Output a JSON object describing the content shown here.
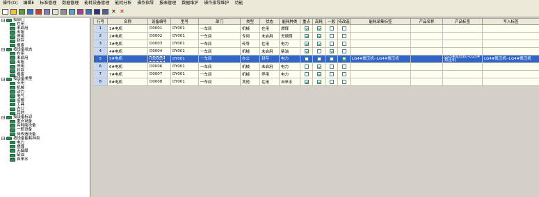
{
  "menu": [
    "操作(O)",
    "编辑E",
    "标准管理",
    "数据管理",
    "能耗设备管理",
    "能耗分析",
    "操作指导",
    "报表管理",
    "数据维护",
    "操作指导维护",
    "功能"
  ],
  "toolbar": {
    "icons": [
      "new-icon",
      "open-icon",
      "save-folder-icon",
      "import-icon",
      "export-icon",
      "grid-icon",
      "report-icon",
      "print-icon",
      "preview-icon",
      "chart-icon",
      "table-icon",
      "disk-icon",
      "save-as-icon",
      "close-x-icon",
      "delete-x-icon"
    ]
  },
  "tree": [
    {
      "level": 0,
      "label": "按部门",
      "expanded": true
    },
    {
      "level": 1,
      "label": "在用"
    },
    {
      "level": 1,
      "label": "未启用"
    },
    {
      "level": 1,
      "label": "出租"
    },
    {
      "level": 1,
      "label": "停用"
    },
    {
      "level": 1,
      "label": "封存"
    },
    {
      "level": 1,
      "label": "报废"
    },
    {
      "level": 0,
      "label": "按设备状态",
      "expanded": true
    },
    {
      "level": 1,
      "label": "在用"
    },
    {
      "level": 1,
      "label": "未启用"
    },
    {
      "level": 1,
      "label": "出租"
    },
    {
      "level": 1,
      "label": "停用"
    },
    {
      "level": 1,
      "label": "封存"
    },
    {
      "level": 1,
      "label": "报废"
    },
    {
      "level": 0,
      "label": "按设备类型",
      "expanded": true
    },
    {
      "level": 1,
      "label": "专用"
    },
    {
      "level": 1,
      "label": "机械"
    },
    {
      "level": 1,
      "label": "动力"
    },
    {
      "level": 1,
      "label": "电气"
    },
    {
      "level": 1,
      "label": "运输"
    },
    {
      "level": 1,
      "label": "工具"
    },
    {
      "level": 1,
      "label": "办公"
    },
    {
      "level": 1,
      "label": "其他"
    },
    {
      "level": 0,
      "label": "按设备标识",
      "expanded": true
    },
    {
      "level": 1,
      "label": "重点设备"
    },
    {
      "level": 1,
      "label": "高耗能设备"
    },
    {
      "level": 1,
      "label": "一般设备"
    },
    {
      "level": 1,
      "label": "待改造设备"
    },
    {
      "level": 0,
      "label": "按设备能耗种类",
      "expanded": true
    },
    {
      "level": 1,
      "label": "电力"
    },
    {
      "level": 1,
      "label": "燃煤"
    },
    {
      "level": 1,
      "label": "无烟煤"
    },
    {
      "level": 1,
      "label": "柴油"
    },
    {
      "level": 1,
      "label": "自来水"
    }
  ],
  "grid": {
    "headers": [
      "行号",
      "名称",
      "设备编号",
      "型号",
      "部门",
      "类型",
      "状态",
      "能耗种类",
      "重点",
      "高耗",
      "一般",
      "待改造",
      "能耗采集标签",
      "产品名称",
      "产品标签",
      "写入标签"
    ],
    "selected_row": 4,
    "rows": [
      {
        "no": "1",
        "name": "1#电机",
        "code": "D0001",
        "model": "DY001",
        "dept": "一车间",
        "type": "机械",
        "status": "在用",
        "energy": "燃煤",
        "k": true,
        "h": true,
        "g": false,
        "w": false,
        "tag": "",
        "pname": "",
        "ptag": "",
        "wtag": ""
      },
      {
        "no": "2",
        "name": "2#电机",
        "code": "D0002",
        "model": "DY001",
        "dept": "一车间",
        "type": "专用",
        "status": "未启用",
        "energy": "无烟煤",
        "k": true,
        "h": true,
        "g": false,
        "w": false,
        "tag": "",
        "pname": "",
        "ptag": "",
        "wtag": ""
      },
      {
        "no": "3",
        "name": "3#电机",
        "code": "D0003",
        "model": "DY001",
        "dept": "一车间",
        "type": "传导",
        "status": "在用",
        "energy": "电力",
        "k": true,
        "h": true,
        "g": false,
        "w": false,
        "tag": "",
        "pname": "",
        "ptag": "",
        "wtag": ""
      },
      {
        "no": "4",
        "name": "4#电机",
        "code": "D0004",
        "model": "DY001",
        "dept": "一车间",
        "type": "机械",
        "status": "未启用",
        "energy": "柴油",
        "k": true,
        "h": false,
        "g": true,
        "w": false,
        "tag": "",
        "pname": "",
        "ptag": "",
        "wtag": ""
      },
      {
        "no": "5",
        "name": "5#电机",
        "code": "D0005",
        "model": "DY001",
        "dept": "一车间",
        "type": "办公",
        "status": "封存",
        "energy": "电力",
        "k": false,
        "h": false,
        "g": false,
        "w": true,
        "tag": "LG4#氮压机--LG4#氮压机",
        "pname": "",
        "ptag": "LG5#氮压机--LG5#氮压机",
        "wtag": "LG4#氮压机--LG4#氮压机"
      },
      {
        "no": "6",
        "name": "6#电机",
        "code": "D0006",
        "model": "DY001",
        "dept": "一车间",
        "type": "机械",
        "status": "未启用",
        "energy": "电力",
        "k": false,
        "h": true,
        "g": false,
        "w": false,
        "tag": "",
        "pname": "",
        "ptag": "",
        "wtag": ""
      },
      {
        "no": "7",
        "name": "7#电机",
        "code": "D0007",
        "model": "DY001",
        "dept": "一车间",
        "type": "机械",
        "status": "停用",
        "energy": "电力",
        "k": false,
        "h": true,
        "g": false,
        "w": false,
        "tag": "",
        "pname": "",
        "ptag": "",
        "wtag": ""
      },
      {
        "no": "8",
        "name": "8#电机",
        "code": "D0008",
        "model": "DY001",
        "dept": "一车间",
        "type": "其他",
        "status": "在用",
        "energy": "自来水",
        "k": true,
        "h": true,
        "g": false,
        "w": false,
        "tag": "",
        "pname": "",
        "ptag": "",
        "wtag": ""
      }
    ]
  }
}
